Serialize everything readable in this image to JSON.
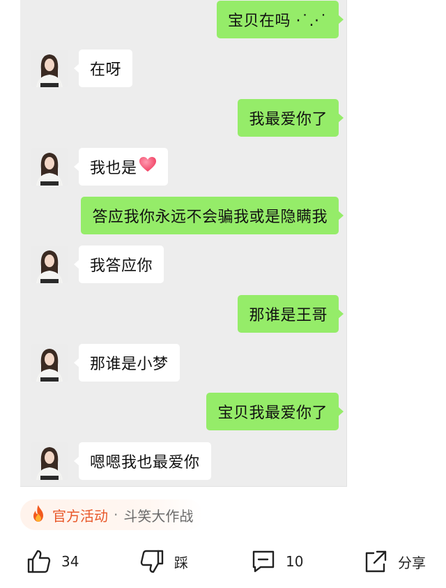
{
  "chat": {
    "messages": [
      {
        "side": "me",
        "text": "宝贝在吗 ·˙.·˙"
      },
      {
        "side": "them",
        "text": "在呀"
      },
      {
        "side": "me",
        "text": "我最爱你了"
      },
      {
        "side": "them",
        "text": "我也是",
        "emoji": "heart-icon"
      },
      {
        "side": "me",
        "text": "答应我你永远不会骗我或是隐瞒我"
      },
      {
        "side": "them",
        "text": "我答应你"
      },
      {
        "side": "me",
        "text": "那谁是王哥"
      },
      {
        "side": "them",
        "text": "那谁是小梦"
      },
      {
        "side": "me",
        "text": "宝贝我最爱你了"
      },
      {
        "side": "them",
        "text": "嗯嗯我也最爱你"
      }
    ],
    "colors": {
      "me_bubble": "#95ec69",
      "them_bubble": "#ffffff",
      "background": "#ededed"
    }
  },
  "tag": {
    "icon": "fire-icon",
    "main": "官方活动",
    "separator": "·",
    "sub": "斗笑大作战",
    "accent": "#e8582a"
  },
  "actions": {
    "like": {
      "icon": "thumbs-up-icon",
      "count": "34"
    },
    "dislike": {
      "icon": "thumbs-down-icon",
      "label": "踩"
    },
    "comment": {
      "icon": "comment-icon",
      "count": "10"
    },
    "share": {
      "icon": "share-icon",
      "label": "分享"
    }
  }
}
